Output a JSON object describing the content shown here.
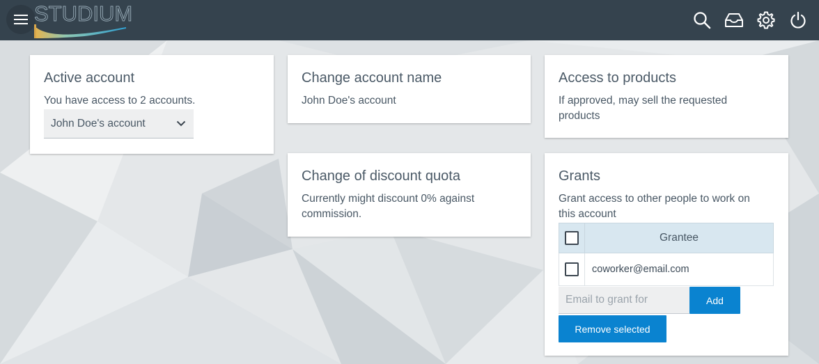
{
  "header": {
    "logo_text": "STUDIUM",
    "icons": [
      "menu-icon",
      "search-icon",
      "inbox-icon",
      "gear-icon",
      "power-icon"
    ]
  },
  "colors": {
    "topbar": "#35434e",
    "primary_button": "#0a83d0",
    "table_header": "#d8e7f0",
    "background": "#e6e9eb"
  },
  "active_account": {
    "title": "Active account",
    "text": "You have access to 2 accounts.",
    "selected": "John Doe's account"
  },
  "change_name": {
    "title": "Change account name",
    "value": "John Doe's account"
  },
  "access_products": {
    "title": "Access to products",
    "text": "If approved, may sell the requested products"
  },
  "discount_quota": {
    "title": "Change of discount quota",
    "text": "Currently might discount 0% against commission."
  },
  "grants": {
    "title": "Grants",
    "text": "Grant access to other people to work on this account",
    "column_header": "Grantee",
    "rows": [
      {
        "email": "coworker@email.com"
      }
    ],
    "input_placeholder": "Email to grant for",
    "add_label": "Add",
    "remove_label": "Remove selected"
  }
}
